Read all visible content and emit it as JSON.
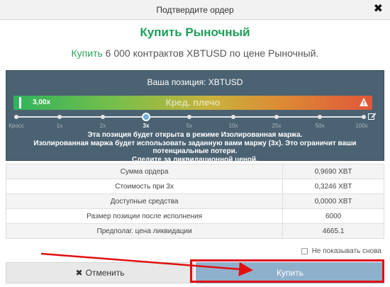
{
  "dialog": {
    "title": "Подтвердите ордер",
    "close_glyph": "✖"
  },
  "order": {
    "type_title": "Купить Рыночный",
    "summary_buy": "Купить",
    "summary_rest": " 6 000 контрактов XBTUSD по цене Рыночный."
  },
  "position": {
    "title": "Ваша позиция: XBTUSD",
    "leverage_value": "3,00x",
    "leverage_caption": "Кред. плечо",
    "ticks": [
      "Кросс",
      "1x",
      "2x",
      "3x",
      "5x",
      "10x",
      "25x",
      "50x",
      "100x"
    ],
    "selected_tick_index": 3,
    "message_line1_prefix": "Эта позиция будет открыта в режиме ",
    "message_line1_bold": "Изолированная маржа.",
    "message_line2": "Изолированная маржа будет использовать заданную вами маржу (3x). Это ограничит ваши потенциальные потери.",
    "message_line3": "Следите за ликвидационной ценой."
  },
  "details": {
    "rows": [
      {
        "label": "Сумма ордера",
        "value": "0,9690 XBT"
      },
      {
        "label": "Стоимость при 3x",
        "value": "0,3246 XBT"
      },
      {
        "label": "Доступные средства",
        "value": "0,0000 XBT"
      },
      {
        "label": "Размер позиции после исполнения",
        "value": "6000"
      },
      {
        "label": "Предполаг. цена ликвидации",
        "value": "4665.1"
      }
    ]
  },
  "footer": {
    "dont_show_label": "Не показывать снова",
    "cancel_label": "Отменить",
    "buy_label": "Купить"
  },
  "colors": {
    "accent_green": "#1e9e58",
    "panel_bg": "#4b6272",
    "buy_button": "#8fb0cb",
    "annotation_red": "#e01010"
  },
  "icons": [
    "close-icon",
    "warning-icon",
    "edit-icon",
    "checkbox-icon",
    "cancel-x-icon"
  ]
}
